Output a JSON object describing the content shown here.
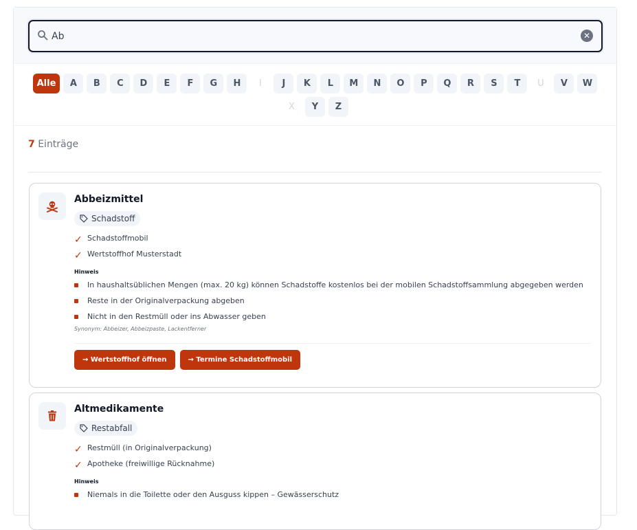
{
  "search": {
    "value": "Ab",
    "placeholder": "",
    "clear_label": "✕"
  },
  "alphabet": {
    "row1": [
      {
        "label": "Alle",
        "state": "active"
      },
      {
        "label": "A",
        "state": "normal"
      },
      {
        "label": "B",
        "state": "normal"
      },
      {
        "label": "C",
        "state": "normal"
      },
      {
        "label": "D",
        "state": "normal"
      },
      {
        "label": "E",
        "state": "normal"
      },
      {
        "label": "F",
        "state": "normal"
      },
      {
        "label": "G",
        "state": "normal"
      },
      {
        "label": "H",
        "state": "normal"
      },
      {
        "label": "I",
        "state": "disabled"
      },
      {
        "label": "J",
        "state": "normal"
      },
      {
        "label": "K",
        "state": "normal"
      },
      {
        "label": "L",
        "state": "normal"
      },
      {
        "label": "M",
        "state": "normal"
      },
      {
        "label": "N",
        "state": "normal"
      },
      {
        "label": "O",
        "state": "normal"
      },
      {
        "label": "P",
        "state": "normal"
      },
      {
        "label": "Q",
        "state": "normal"
      },
      {
        "label": "R",
        "state": "normal"
      },
      {
        "label": "S",
        "state": "normal"
      },
      {
        "label": "T",
        "state": "normal"
      },
      {
        "label": "U",
        "state": "disabled"
      },
      {
        "label": "V",
        "state": "normal"
      },
      {
        "label": "W",
        "state": "normal"
      }
    ],
    "row2": [
      {
        "label": "X",
        "state": "disabled"
      },
      {
        "label": "Y",
        "state": "normal"
      },
      {
        "label": "Z",
        "state": "normal"
      }
    ]
  },
  "results": {
    "count": "7",
    "label": "Einträge"
  },
  "cards": [
    {
      "icon": "skull-crossbones-icon",
      "title": "Abbeizmittel",
      "tag": "Schadstoff",
      "destinations": [
        "Schadstoffmobil",
        "Wertstoffhof Musterstadt"
      ],
      "hint_label": "Hinweis",
      "hints": [
        "In haushaltsüblichen Mengen (max. 20 kg) können Schadstoffe kostenlos bei der mobilen Schadstoffsammlung abgegeben werden",
        "Reste in der Originalverpackung abgeben",
        "Nicht in den Restmüll oder ins Abwasser geben"
      ],
      "synonym": "Synonym: Abbeizer, Abbeizpaste, Lackentferner",
      "actions": [
        "→ Wertstoffhof öffnen",
        "→ Termine Schadstoffmobil"
      ]
    },
    {
      "icon": "trash-can-icon",
      "title": "Altmedikamente",
      "tag": "Restabfall",
      "destinations": [
        "Restmüll (in Originalverpackung)",
        "Apotheke (freiwillige Rücknahme)"
      ],
      "hint_label": "Hinweis",
      "hints": [
        "Niemals in die Toilette oder den Ausguss kippen – Gewässerschutz"
      ]
    }
  ],
  "colors": {
    "accent": "#c0360c",
    "muted_bg": "#f1f4f8",
    "text": "#111827"
  }
}
